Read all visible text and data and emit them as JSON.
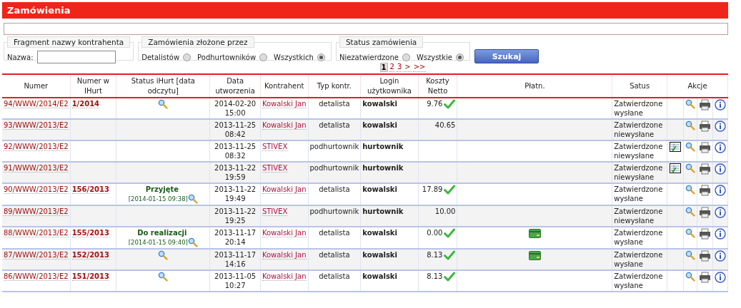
{
  "header": {
    "title": "Zamówienia"
  },
  "filters": {
    "name_group": {
      "legend": "Fragment nazwy kontrahenta",
      "label": "Nazwa:"
    },
    "placed_by": {
      "legend": "Zamówienia złożone przez",
      "options": [
        {
          "label": "Detalistów",
          "selected": false
        },
        {
          "label": "Podhurtowników",
          "selected": false
        },
        {
          "label": "Wszystkich",
          "selected": true
        }
      ]
    },
    "status": {
      "legend": "Status zamówienia",
      "options": [
        {
          "label": "Niezatwierdzone",
          "selected": false
        },
        {
          "label": "Wszystkie",
          "selected": true
        }
      ]
    },
    "search_button": "Szukaj"
  },
  "pagination": [
    {
      "label": "1",
      "selected": true
    },
    {
      "label": "2",
      "selected": false
    },
    {
      "label": "3",
      "selected": false
    },
    {
      "label": ">",
      "selected": false
    },
    {
      "label": ">>",
      "selected": false
    }
  ],
  "table": {
    "columns": [
      "Numer",
      "Numer w IHurt",
      "Status iHurt [data odczytu]",
      "Data utworzenia",
      "Kontrahent",
      "Typ kontr.",
      "Login użytkownika",
      "Koszty Netto",
      "Płatn.",
      "Satus",
      "Akcje"
    ],
    "rows": [
      {
        "numer": "94/WWW/2014/E2",
        "ihurt": "1/2014",
        "status_label": "",
        "status_date": "",
        "read_icon": true,
        "created": "2014-02-20 15:00",
        "contractor": "Kowalski Jan",
        "type": "detalista",
        "login": "kowalski",
        "cost": "9.76",
        "cost_ok": true,
        "payment_card": false,
        "status": "Zatwierdzone wysłane",
        "form_icon": false
      },
      {
        "numer": "93/WWW/2013/E2",
        "ihurt": "",
        "status_label": "",
        "status_date": "",
        "read_icon": false,
        "created": "2013-11-25 08:42",
        "contractor": "Kowalski Jan",
        "type": "detalista",
        "login": "kowalski",
        "cost": "40.65",
        "cost_ok": false,
        "payment_card": false,
        "status": "Zatwierdzone niewysłane",
        "form_icon": false
      },
      {
        "numer": "92/WWW/2013/E2",
        "ihurt": "",
        "status_label": "",
        "status_date": "",
        "read_icon": false,
        "created": "2013-11-25 08:32",
        "contractor": "STIVEX",
        "type": "podhurtownik",
        "login": "hurtownik",
        "cost": "",
        "cost_ok": false,
        "payment_card": false,
        "status": "Zatwierdzone niewysłane",
        "form_icon": true
      },
      {
        "numer": "91/WWW/2013/E2",
        "ihurt": "",
        "status_label": "",
        "status_date": "",
        "read_icon": false,
        "created": "2013-11-22 19:59",
        "contractor": "STIVEX",
        "type": "podhurtownik",
        "login": "hurtownik",
        "cost": "",
        "cost_ok": false,
        "payment_card": false,
        "status": "Zatwierdzone niewysłane",
        "form_icon": true
      },
      {
        "numer": "90/WWW/2013/E2",
        "ihurt": "156/2013",
        "status_label": "Przyjęte",
        "status_date": "[2014-01-15 09:38]",
        "read_icon": true,
        "created": "2013-11-22 19:49",
        "contractor": "Kowalski Jan",
        "type": "detalista",
        "login": "kowalski",
        "cost": "17.89",
        "cost_ok": true,
        "payment_card": false,
        "status": "Zatwierdzone wysłane",
        "form_icon": false
      },
      {
        "numer": "89/WWW/2013/E2",
        "ihurt": "",
        "status_label": "",
        "status_date": "",
        "read_icon": false,
        "created": "2013-11-22 19:25",
        "contractor": "STIVEX",
        "type": "podhurtownik",
        "login": "hurtownik",
        "cost": "10.00",
        "cost_ok": false,
        "payment_card": false,
        "status": "Zatwierdzone niewysłane",
        "form_icon": false
      },
      {
        "numer": "88/WWW/2013/E2",
        "ihurt": "155/2013",
        "status_label": "Do realizacji",
        "status_date": "[2014-01-15 09:40]",
        "read_icon": true,
        "created": "2013-11-17 20:14",
        "contractor": "Kowalski Jan",
        "type": "detalista",
        "login": "kowalski",
        "cost": "0.00",
        "cost_ok": true,
        "payment_card": true,
        "status": "Zatwierdzone wysłane",
        "form_icon": false
      },
      {
        "numer": "87/WWW/2013/E2",
        "ihurt": "152/2013",
        "status_label": "",
        "status_date": "",
        "read_icon": true,
        "created": "2013-11-17 14:16",
        "contractor": "Kowalski Jan",
        "type": "detalista",
        "login": "kowalski",
        "cost": "8.13",
        "cost_ok": true,
        "payment_card": true,
        "status": "Zatwierdzone wysłane",
        "form_icon": false
      },
      {
        "numer": "86/WWW/2013/E2",
        "ihurt": "151/2013",
        "status_label": "",
        "status_date": "",
        "read_icon": true,
        "created": "2013-11-05 10:27",
        "contractor": "Kowalski Jan",
        "type": "detalista",
        "login": "kowalski",
        "cost": "8.13",
        "cost_ok": true,
        "payment_card": false,
        "status": "Zatwierdzone wysłane",
        "form_icon": false
      }
    ]
  }
}
